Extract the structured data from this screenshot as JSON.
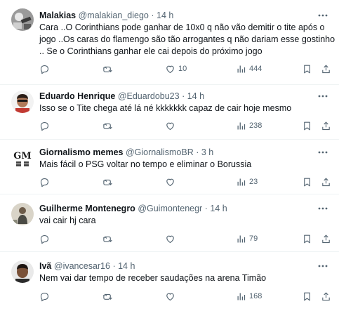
{
  "tweets": [
    {
      "name": "Malakias",
      "handle": "@malakian_diego",
      "sep": "·",
      "time": "14 h",
      "lines": [
        "Cara ..O Corinthians pode ganhar de 10x0 q não vão demitir o tite após o",
        "jogo ..Os caras do flamengo são tão arrogantes q não dariam esse gostinho",
        ".. Se o Corinthians ganhar ele cai depois do próximo jogo"
      ],
      "likes": "10",
      "views": "444"
    },
    {
      "name": "Eduardo Henrique",
      "handle": "@Eduardobu23",
      "sep": "·",
      "time": "14 h",
      "lines": [
        "Isso se o Tite chega até lá né kkkkkkk capaz de cair hoje mesmo"
      ],
      "likes": "",
      "views": "238"
    },
    {
      "name": "Giornalismo memes",
      "handle": "@GiornalismoBR",
      "sep": "·",
      "time": "3 h",
      "lines": [
        "Mais fácil o PSG voltar no tempo e eliminar o Borussia"
      ],
      "likes": "",
      "views": "23",
      "avatar_text": "GM"
    },
    {
      "name": "Guilherme Montenegro",
      "handle": "@Guimontenegr",
      "sep": "·",
      "time": "14 h",
      "lines": [
        "vai cair hj cara"
      ],
      "likes": "",
      "views": "79"
    },
    {
      "name": "Ivã",
      "handle": "@ivancesar16",
      "sep": "·",
      "time": "14 h",
      "lines": [
        "Nem vai dar tempo de receber saudações na arena Timão"
      ],
      "likes": "",
      "views": "168"
    }
  ],
  "icons": {
    "reply": "reply-icon",
    "retweet": "retweet-icon",
    "like": "like-icon",
    "views": "views-icon",
    "bookmark": "bookmark-icon",
    "share": "share-icon",
    "more": "more-icon"
  },
  "colors": {
    "text": "#0f1419",
    "secondary": "#536471",
    "divider": "#eff3f4"
  }
}
